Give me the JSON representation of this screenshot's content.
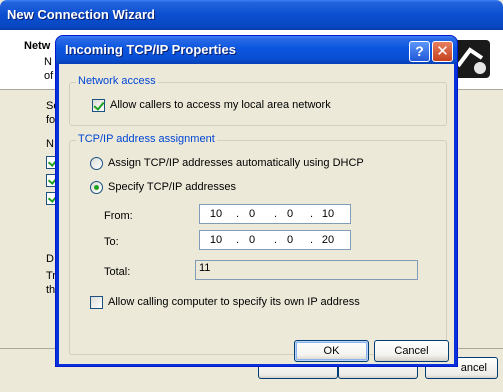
{
  "wizard": {
    "title": "New Connection Wizard",
    "header_title": "Netw",
    "header_sub1": "N",
    "header_sub2": "of",
    "body_line1": "Se",
    "body_line2": "fo",
    "body_line3": "N",
    "body_line4": "D",
    "body_line5": "Tr",
    "body_line6": "th",
    "cancel_label": "ancel"
  },
  "dialog": {
    "title": "Incoming TCP/IP Properties",
    "help_glyph": "?",
    "close_glyph": "✕",
    "network_access": {
      "group_label": "Network access",
      "allow_callers_label": "Allow callers to access my local area network",
      "allow_callers_checked": true
    },
    "address_assignment": {
      "group_label": "TCP/IP address assignment",
      "dhcp_label": "Assign TCP/IP addresses automatically using DHCP",
      "specify_label": "Specify TCP/IP addresses",
      "selected": "specify",
      "from_label": "From:",
      "from_ip": [
        "10",
        "0",
        "0",
        "10"
      ],
      "to_label": "To:",
      "to_ip": [
        "10",
        "0",
        "0",
        "20"
      ],
      "total_label": "Total:",
      "total_value": "11"
    },
    "allow_own_ip_label": "Allow calling computer to specify its own IP address",
    "allow_own_ip_checked": false,
    "ok_label": "OK",
    "cancel_label": "Cancel"
  }
}
